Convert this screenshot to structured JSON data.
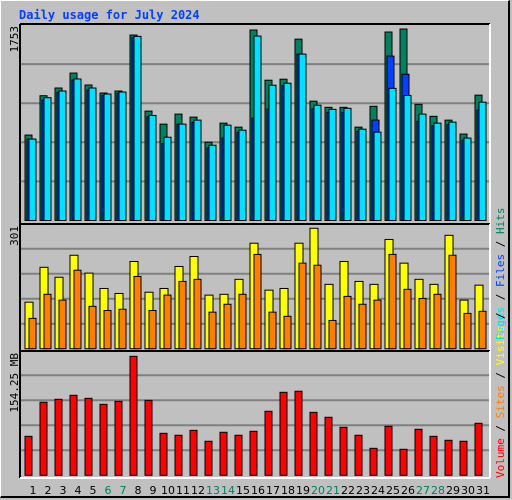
{
  "title": "Daily usage for July 2024",
  "colors": {
    "background": "#c0c0c0",
    "grid": "#808080",
    "hits": "#008060",
    "files": "#00e0ff",
    "pages": "#0040ff",
    "visits": "#ffff00",
    "sites": "#ff8000",
    "volume": "#ff0000",
    "weekday_label": "#000000",
    "weekend_label": "#00805c",
    "title": "#0040ff"
  },
  "chart_data": [
    {
      "type": "bar",
      "panel": "top",
      "title": "Daily usage for July 2024",
      "categories": [
        "1",
        "2",
        "3",
        "4",
        "5",
        "6",
        "7",
        "8",
        "9",
        "10",
        "11",
        "12",
        "13",
        "14",
        "15",
        "16",
        "17",
        "18",
        "19",
        "20",
        "21",
        "22",
        "23",
        "24",
        "25",
        "26",
        "27",
        "28",
        "29",
        "30",
        "31"
      ],
      "weekend_days": [
        "6",
        "7",
        "13",
        "14",
        "20",
        "21",
        "27",
        "28"
      ],
      "ylim": [
        0,
        1753
      ],
      "ymax_label": "1753",
      "gridlines": 4,
      "series": [
        {
          "name": "Hits",
          "values": [
            766,
            1119,
            1188,
            1322,
            1215,
            1143,
            1161,
            1663,
            981,
            864,
            954,
            927,
            702,
            873,
            837,
            1708,
            1258,
            1267,
            1626,
            1070,
            1015,
            1015,
            837,
            1024,
            1690,
            1717,
            1042,
            934,
            900,
            775,
            1124
          ]
        },
        {
          "name": "Pages",
          "values": [
            730,
            1080,
            1150,
            1260,
            1170,
            1120,
            1140,
            1640,
            930,
            690,
            864,
            880,
            650,
            740,
            790,
            918,
            999,
            1209,
            1492,
            1000,
            970,
            970,
            800,
            900,
            1474,
            1311,
            890,
            850,
            860,
            720,
            990
          ]
        },
        {
          "name": "Files",
          "values": [
            730,
            1101,
            1161,
            1269,
            1188,
            1134,
            1152,
            1651,
            942,
            747,
            864,
            900,
            675,
            855,
            810,
            1654,
            1213,
            1231,
            1492,
            1034,
            997,
            1006,
            819,
            792,
            1185,
            1121,
            954,
            873,
            882,
            739,
            1061
          ]
        }
      ]
    },
    {
      "type": "bar",
      "panel": "middle",
      "categories": [
        "1",
        "2",
        "3",
        "4",
        "5",
        "6",
        "7",
        "8",
        "9",
        "10",
        "11",
        "12",
        "13",
        "14",
        "15",
        "16",
        "17",
        "18",
        "19",
        "20",
        "21",
        "22",
        "23",
        "24",
        "25",
        "26",
        "27",
        "28",
        "29",
        "30",
        "31"
      ],
      "ylim": [
        0,
        301
      ],
      "ymax_label": "301",
      "gridlines": 4,
      "series": [
        {
          "name": "Visits",
          "values": [
            112,
            196,
            172,
            225,
            182,
            145,
            133,
            210,
            136,
            145,
            198,
            222,
            129,
            131,
            167,
            254,
            141,
            145,
            254,
            290,
            155,
            210,
            162,
            155,
            263,
            206,
            167,
            155,
            273,
            117,
            153
          ]
        },
        {
          "name": "Sites",
          "values": [
            73,
            131,
            117,
            189,
            102,
            92,
            95,
            174,
            92,
            129,
            162,
            167,
            88,
            107,
            131,
            227,
            88,
            78,
            206,
            201,
            68,
            126,
            107,
            117,
            227,
            143,
            121,
            131,
            225,
            85,
            90
          ]
        }
      ]
    },
    {
      "type": "bar",
      "panel": "bottom",
      "categories": [
        "1",
        "2",
        "3",
        "4",
        "5",
        "6",
        "7",
        "8",
        "9",
        "10",
        "11",
        "12",
        "13",
        "14",
        "15",
        "16",
        "17",
        "18",
        "19",
        "20",
        "21",
        "22",
        "23",
        "24",
        "25",
        "26",
        "27",
        "28",
        "29",
        "30",
        "31"
      ],
      "ylim": [
        0,
        154.25
      ],
      "ymax_label": "154.25 MB",
      "unit": "MB",
      "gridlines": 4,
      "series": [
        {
          "name": "Volume",
          "values": [
            48.1,
            90.1,
            93.8,
            98.7,
            95.0,
            87.6,
            91.3,
            146.8,
            92.5,
            51.8,
            49.4,
            55.5,
            42.0,
            53.1,
            49.4,
            54.3,
            79.0,
            102.4,
            103.7,
            77.7,
            71.6,
            59.2,
            49.4,
            33.3,
            60.5,
            32.1,
            56.8,
            48.1,
            43.2,
            42.0,
            64.2
          ]
        }
      ]
    }
  ],
  "legend": {
    "middle_right": [
      {
        "label": "Pages",
        "color": "#00e0ff"
      },
      {
        "label": " / ",
        "color": "#000000"
      },
      {
        "label": "Files",
        "color": "#0040ff"
      },
      {
        "label": " / ",
        "color": "#000000"
      },
      {
        "label": "Hits",
        "color": "#008060"
      }
    ],
    "bottom_right": [
      {
        "label": "Volume",
        "color": "#ff0000"
      },
      {
        "label": " / ",
        "color": "#000000"
      },
      {
        "label": "Sites",
        "color": "#ff8000"
      },
      {
        "label": " / ",
        "color": "#000000"
      },
      {
        "label": "Visits",
        "color": "#ffff00"
      },
      {
        "label": " / ",
        "color": "#000000"
      }
    ]
  }
}
